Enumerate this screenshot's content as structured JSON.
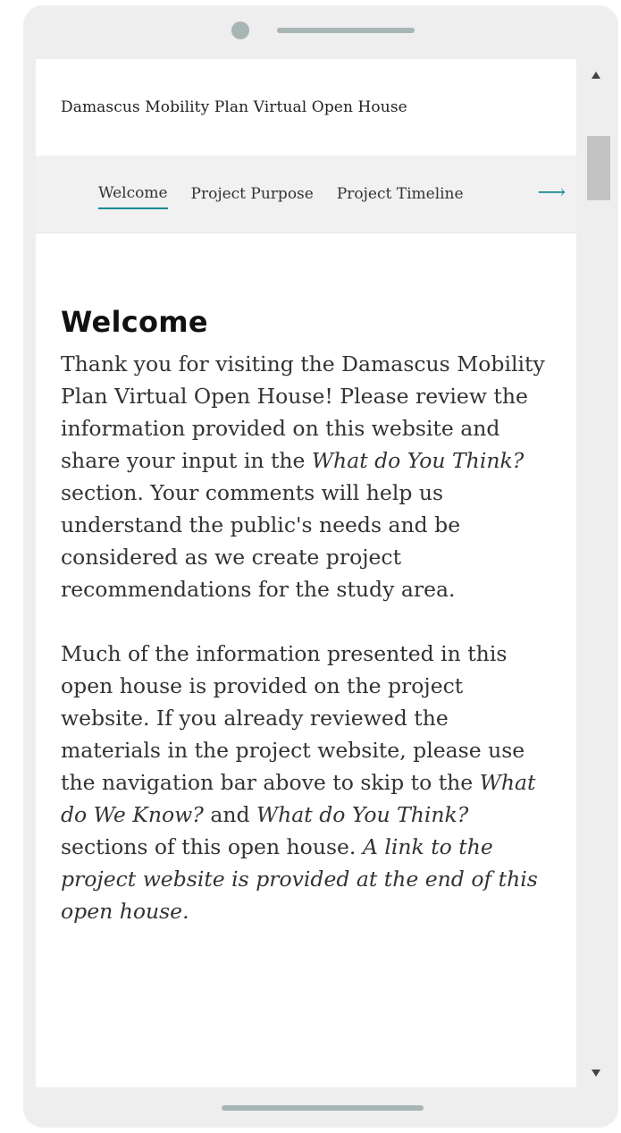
{
  "app": {
    "title": "Damascus Mobility Plan Virtual Open House"
  },
  "nav": {
    "tabs": [
      {
        "label": "Welcome",
        "active": true
      },
      {
        "label": "Project Purpose",
        "active": false
      },
      {
        "label": "Project Timeline",
        "active": false
      }
    ],
    "next_icon": "arrow-right-icon",
    "next_glyph": "⟶",
    "accent_color": "#1a8a92"
  },
  "welcome": {
    "heading": "Welcome",
    "p1": {
      "a": "Thank you for visiting the Damascus Mobility Plan Virtual Open House! Please review the information provided on this website and share your input in the ",
      "b": "What do You Think?",
      "c": " section. Your comments will help us understand the public's needs and be considered as we create project recommendations for the study area."
    },
    "p2": {
      "a": "Much of the information presented in this open house is provided on the project website. If you already reviewed the materials in the project website, please use the navigation bar above to skip to the ",
      "b": "What do We Know?",
      "c": " and ",
      "d": "What do You Think?",
      "e": " sections of this open house. ",
      "f": "A link to the project website is provided at the end of this open house."
    }
  },
  "scrollbar": {
    "up_icon": "scroll-up-arrow-icon",
    "down_icon": "scroll-down-arrow-icon"
  }
}
